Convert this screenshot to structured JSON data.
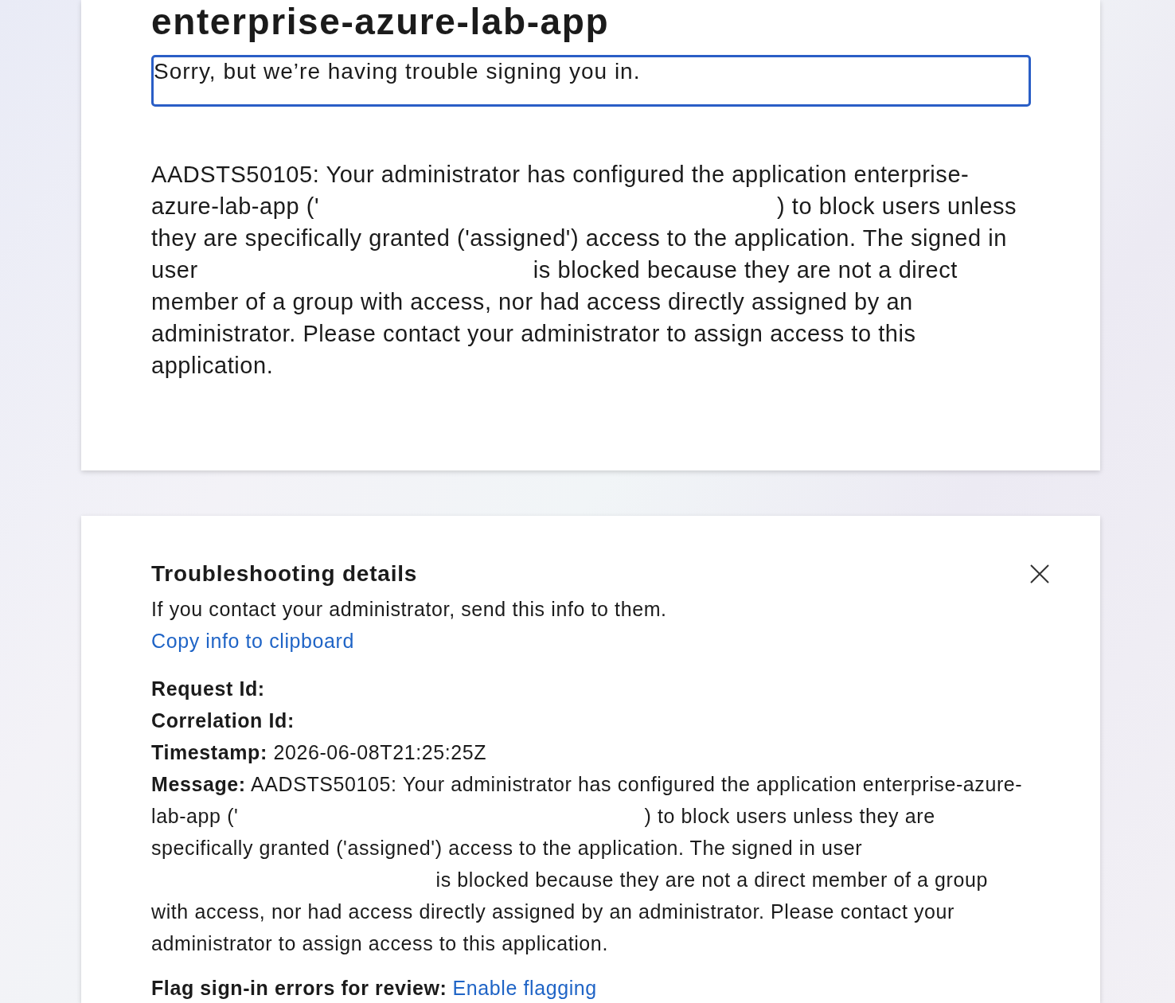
{
  "app_title": "enterprise-azure-lab-app",
  "error_card": {
    "heading": "Sorry, but we’re having trouble signing you in.",
    "heading_focused": true,
    "message_parts": [
      "AADSTS50105: Your administrator has configured the application enterprise-azure-lab-app ('",
      ") to block users unless they are specifically granted ('assigned') access to the application. The signed in user",
      "is blocked because they are not a direct member of a group with access, nor had access directly assigned by an administrator. Please contact your administrator to assign access to this application."
    ]
  },
  "troubleshooting": {
    "title": "Troubleshooting details",
    "intro": "If you contact your administrator, send this info to them.",
    "copy_link": "Copy info to clipboard",
    "details": [
      {
        "kind": "text",
        "label": "Request Id:"
      },
      {
        "kind": "text",
        "label": "Correlation Id:"
      },
      {
        "kind": "text",
        "label": "Timestamp:",
        "value": "2026-06-08T21:25:25Z"
      },
      {
        "kind": "message",
        "label": "Message:",
        "parts": [
          "AADSTS50105: Your administrator has configured the application enterprise-azure-lab-app ('",
          ") to block users unless they are specifically granted ('assigned') access to the application. The signed in user",
          "is blocked because they are not a direct member of a group with access, nor had access directly assigned by an administrator. Please contact your administrator to assign access to this application."
        ]
      },
      {
        "kind": "link",
        "label": "Flag sign-in errors for review:",
        "link": "Enable flagging"
      }
    ]
  }
}
